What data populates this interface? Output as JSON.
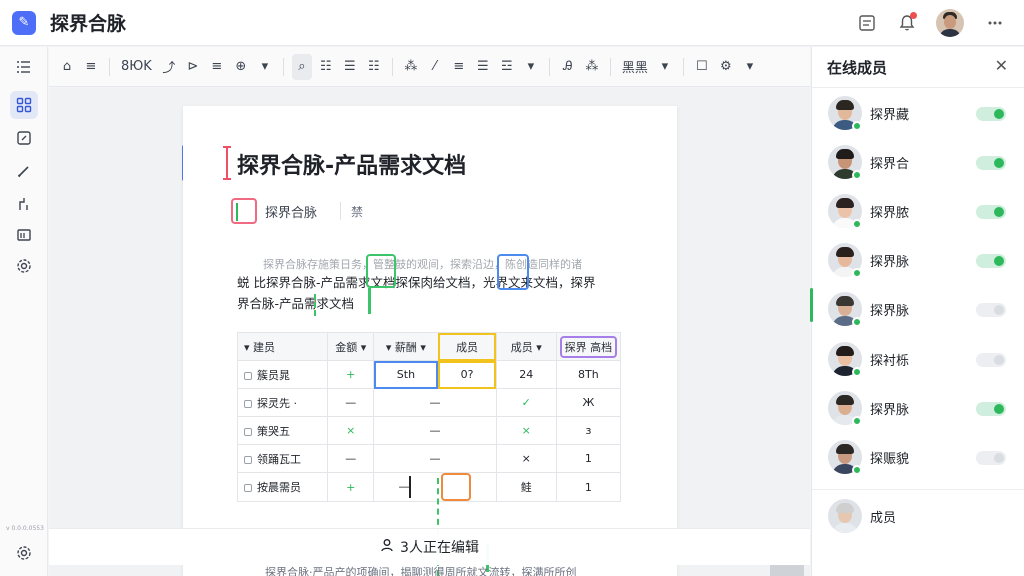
{
  "header": {
    "title": "探界合脉",
    "logo_glyph": "✎",
    "icons": [
      "list-icon",
      "bell-icon",
      "avatar",
      "more-icon"
    ]
  },
  "rail": {
    "icons": [
      "menu-icon",
      "grid-icon",
      "note-icon",
      "pen-icon",
      "branch-icon",
      "board-icon",
      "settings-icon"
    ],
    "version": "v 0.0.0.0553",
    "footer_icon": "settings-icon"
  },
  "toolbar": {
    "items": [
      "⌂",
      "≡",
      "8ЮΚ",
      "⤴",
      "⊳",
      "≡",
      "⊕",
      "▾",
      "⌕",
      "☷",
      "☰",
      "☷",
      "⁂",
      "⁄",
      "≡",
      "☰",
      "☲",
      "▾",
      "Ꭿ",
      "⁂",
      "☷",
      "▾",
      "☐",
      "⚙",
      "▾"
    ],
    "font_label": "8ЮΚ",
    "style_label": "黑黑"
  },
  "doc": {
    "title": "探界合脉-产品需求文档",
    "author": "探界合脉",
    "author_extra": "禁",
    "ghost_line": "探界合脉存施策日务，管整鼓的观间，探索沿边，陈创造同样的诸",
    "body_line1": "蜕 比探界合脉-产品需求文档探保肉给文档，光界文来文档，探界",
    "body_line2": "界合脉-产品需求文档",
    "bottom_ghost": "探界合脉·严品产的项确间，揭聊测得周所就文流转，探满所所创"
  },
  "table": {
    "headers": [
      "建员",
      "金额",
      "薪酬",
      "成员",
      "成员",
      "探界 高档"
    ],
    "rows": [
      [
        "簇员晁",
        "+",
        "Sth",
        "0?",
        "24",
        "8Th"
      ],
      [
        "探灵先 ·",
        "—",
        "—",
        "",
        "✓",
        "Ж"
      ],
      [
        "策哭五",
        "×",
        "—",
        "",
        "×",
        "з"
      ],
      [
        "领踊瓦工",
        "—",
        "—",
        "",
        "×",
        "1"
      ],
      [
        "按晨需员",
        "+",
        "—",
        "",
        "鲑",
        "1"
      ]
    ]
  },
  "editing_bar": {
    "text": "3人正在编辑",
    "icon": "user-icon"
  },
  "panel": {
    "title": "在线成员",
    "members": [
      {
        "name": "探界藏",
        "toggle": "on",
        "online": true,
        "hair": "#2b2622",
        "skin": "#e2b89a",
        "shirt": "#3d5a80"
      },
      {
        "name": "探界合",
        "toggle": "on",
        "online": true,
        "hair": "#1f1c1a",
        "skin": "#c89478",
        "shirt": "#2f3b2f"
      },
      {
        "name": "探界脓",
        "toggle": "on",
        "online": true,
        "hair": "#2c2220",
        "skin": "#ecc3a8",
        "shirt": "#fafafa"
      },
      {
        "name": "探界脉",
        "toggle": "on",
        "online": true,
        "hair": "#2a201c",
        "skin": "#e6b99c",
        "shirt": "#f4f4f4"
      },
      {
        "name": "探界脉",
        "toggle": "off",
        "online": true,
        "hair": "#3a3632",
        "skin": "#d9b096",
        "shirt": "#5b6d86"
      },
      {
        "name": "探衬栎",
        "toggle": "off",
        "online": true,
        "hair": "#221c1a",
        "skin": "#e9c0a2",
        "shirt": "#1d2430"
      },
      {
        "name": "探界脉",
        "toggle": "on",
        "online": true,
        "hair": "#2b2723",
        "skin": "#dcae90",
        "shirt": "#e6e9ee"
      },
      {
        "name": "探赈貌",
        "toggle": "off",
        "online": true,
        "hair": "#2a2724",
        "skin": "#c99a80",
        "shirt": "#3a4660"
      },
      {
        "name": "成员",
        "toggle": "none",
        "online": false,
        "hair": "#cfcfcf",
        "skin": "#e6c7b1",
        "shirt": "#e9ecf0"
      }
    ]
  }
}
